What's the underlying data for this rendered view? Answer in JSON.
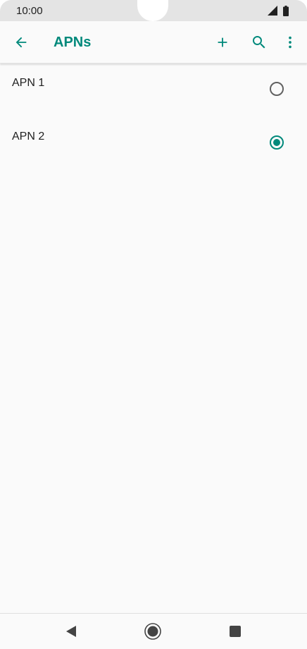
{
  "status_bar": {
    "time": "10:00",
    "icons": [
      "signal-icon",
      "battery-icon"
    ]
  },
  "app_bar": {
    "title": "APNs",
    "actions": [
      "back-arrow-icon",
      "add-icon",
      "search-icon",
      "more-vert-icon"
    ]
  },
  "apn_list": {
    "items": [
      {
        "label": "APN 1",
        "selected": false
      },
      {
        "label": "APN 2",
        "selected": true
      }
    ]
  },
  "nav_bar": {
    "buttons": [
      "nav-back-icon",
      "nav-home-icon",
      "nav-recents-icon"
    ]
  },
  "colors": {
    "accent": "#00897b",
    "text": "#212121",
    "background": "#fafafa",
    "status_bar": "#e4e4e4"
  }
}
